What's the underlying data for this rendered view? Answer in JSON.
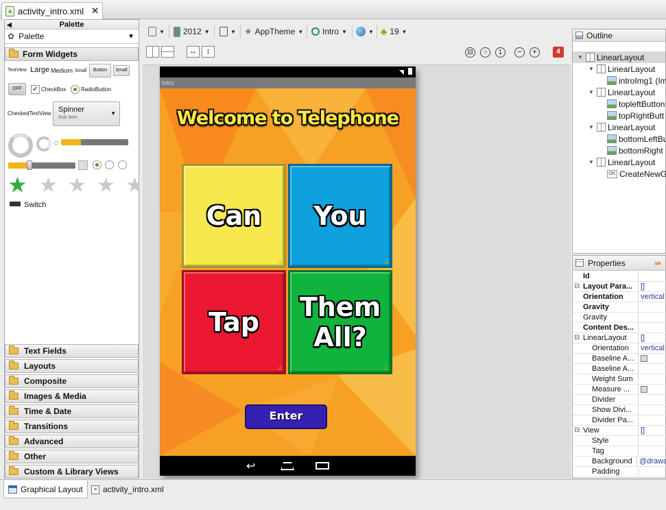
{
  "file_tab": {
    "label": "activity_intro.xml"
  },
  "palette": {
    "header": "Palette",
    "selector": "Palette",
    "open_category": "Form Widgets",
    "widgets": {
      "textview": "TextView",
      "large": "Large",
      "medium": "Medium",
      "small": "Small",
      "button": "Button",
      "small_button": "Small",
      "off": "OFF",
      "checkbox": "CheckBox",
      "radiobutton": "RadioButton",
      "checkedtextview": "CheckedTextView",
      "spinner": "Spinner",
      "spinner_sub": "Sub Item",
      "switch": "Switch"
    },
    "categories": [
      "Text Fields",
      "Layouts",
      "Composite",
      "Images & Media",
      "Time & Date",
      "Transitions",
      "Advanced",
      "Other",
      "Custom & Library Views"
    ]
  },
  "toolbar": {
    "device": "2012",
    "theme": "AppTheme",
    "activity": "Intro",
    "api": "19",
    "error_count": "4"
  },
  "app": {
    "title": "Intro",
    "heading": "Welcome to Telephone",
    "tiles": [
      "Can",
      "You",
      "Tap",
      "Them All?"
    ],
    "tile_colors": [
      "#f7e84e",
      "#0fa0de",
      "#ec1832",
      "#10b43c"
    ],
    "enter": "Enter"
  },
  "outline": {
    "header": "Outline",
    "items": [
      "LinearLayout",
      "LinearLayout",
      "introImg1 (Im",
      "LinearLayout",
      "topleftButton",
      "topRightButt",
      "LinearLayout",
      "bottomLeftBu",
      "bottomRight",
      "LinearLayout",
      "CreateNewGa"
    ]
  },
  "properties": {
    "header": "Properties",
    "rows": [
      {
        "name": "Id",
        "value": "",
        "bold": true
      },
      {
        "name": "Layout Para...",
        "value": "[]",
        "bold": true
      },
      {
        "name": "Orientation",
        "value": "vertical",
        "bold": true
      },
      {
        "name": "Gravity",
        "value": "",
        "bold": true
      },
      {
        "name": "Gravity",
        "value": "",
        "bold": false
      },
      {
        "name": "Content Des...",
        "value": "",
        "bold": true
      },
      {
        "name": "LinearLayout",
        "value": "[]",
        "bold": false
      },
      {
        "name": "Orientation",
        "value": "vertical",
        "bold": false
      },
      {
        "name": "Baseline A...",
        "value": "",
        "bold": false
      },
      {
        "name": "Baseline A...",
        "value": "",
        "bold": false
      },
      {
        "name": "Weight Sum",
        "value": "",
        "bold": false
      },
      {
        "name": "Measure ...",
        "value": "",
        "bold": false
      },
      {
        "name": "Divider",
        "value": "",
        "bold": false
      },
      {
        "name": "Show Divi...",
        "value": "",
        "bold": false
      },
      {
        "name": "Divider Pa...",
        "value": "",
        "bold": false
      },
      {
        "name": "View",
        "value": "[]",
        "bold": false
      },
      {
        "name": "Style",
        "value": "",
        "bold": false
      },
      {
        "name": "Tag",
        "value": "",
        "bold": false
      },
      {
        "name": "Background",
        "value": "@drawa",
        "bold": false
      },
      {
        "name": "Padding",
        "value": "",
        "bold": false
      }
    ]
  },
  "bottom_tabs": {
    "graphical": "Graphical Layout",
    "xml": "activity_intro.xml"
  }
}
